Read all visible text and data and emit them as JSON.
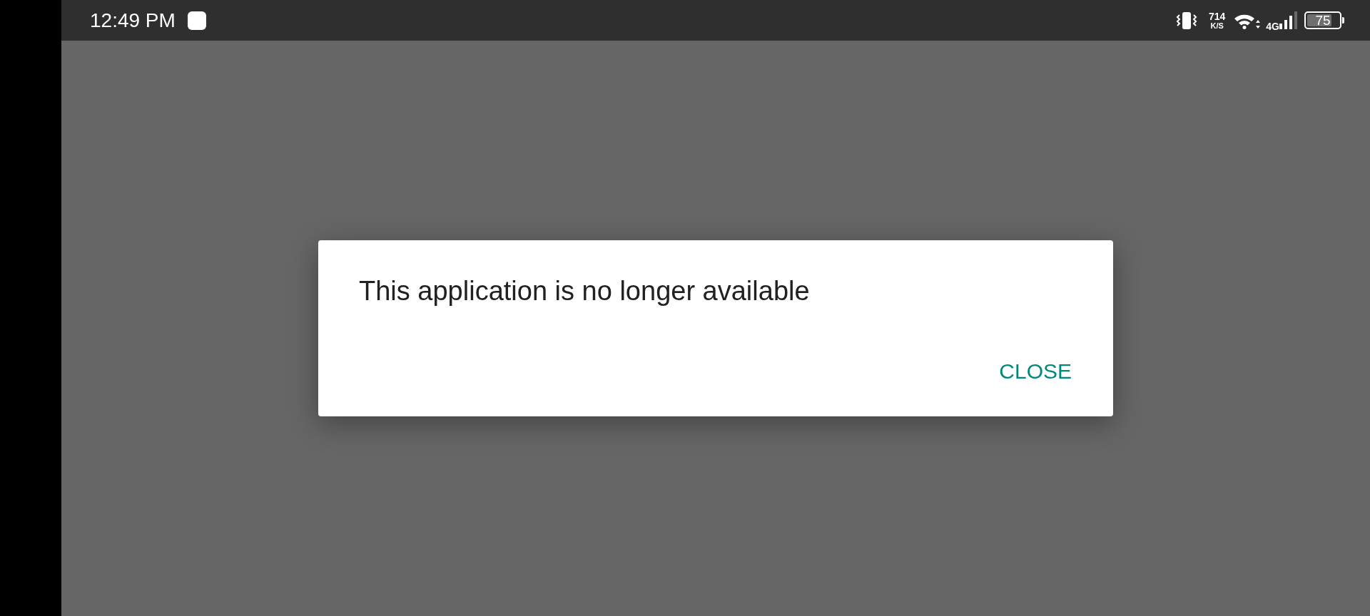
{
  "status_bar": {
    "time": "12:49 PM",
    "network_speed": {
      "value": "714",
      "unit": "K/S"
    },
    "network_type": "4G",
    "battery": "75"
  },
  "dialog": {
    "message": "This application is no longer available",
    "buttons": [
      {
        "label": "CLOSE"
      }
    ]
  }
}
